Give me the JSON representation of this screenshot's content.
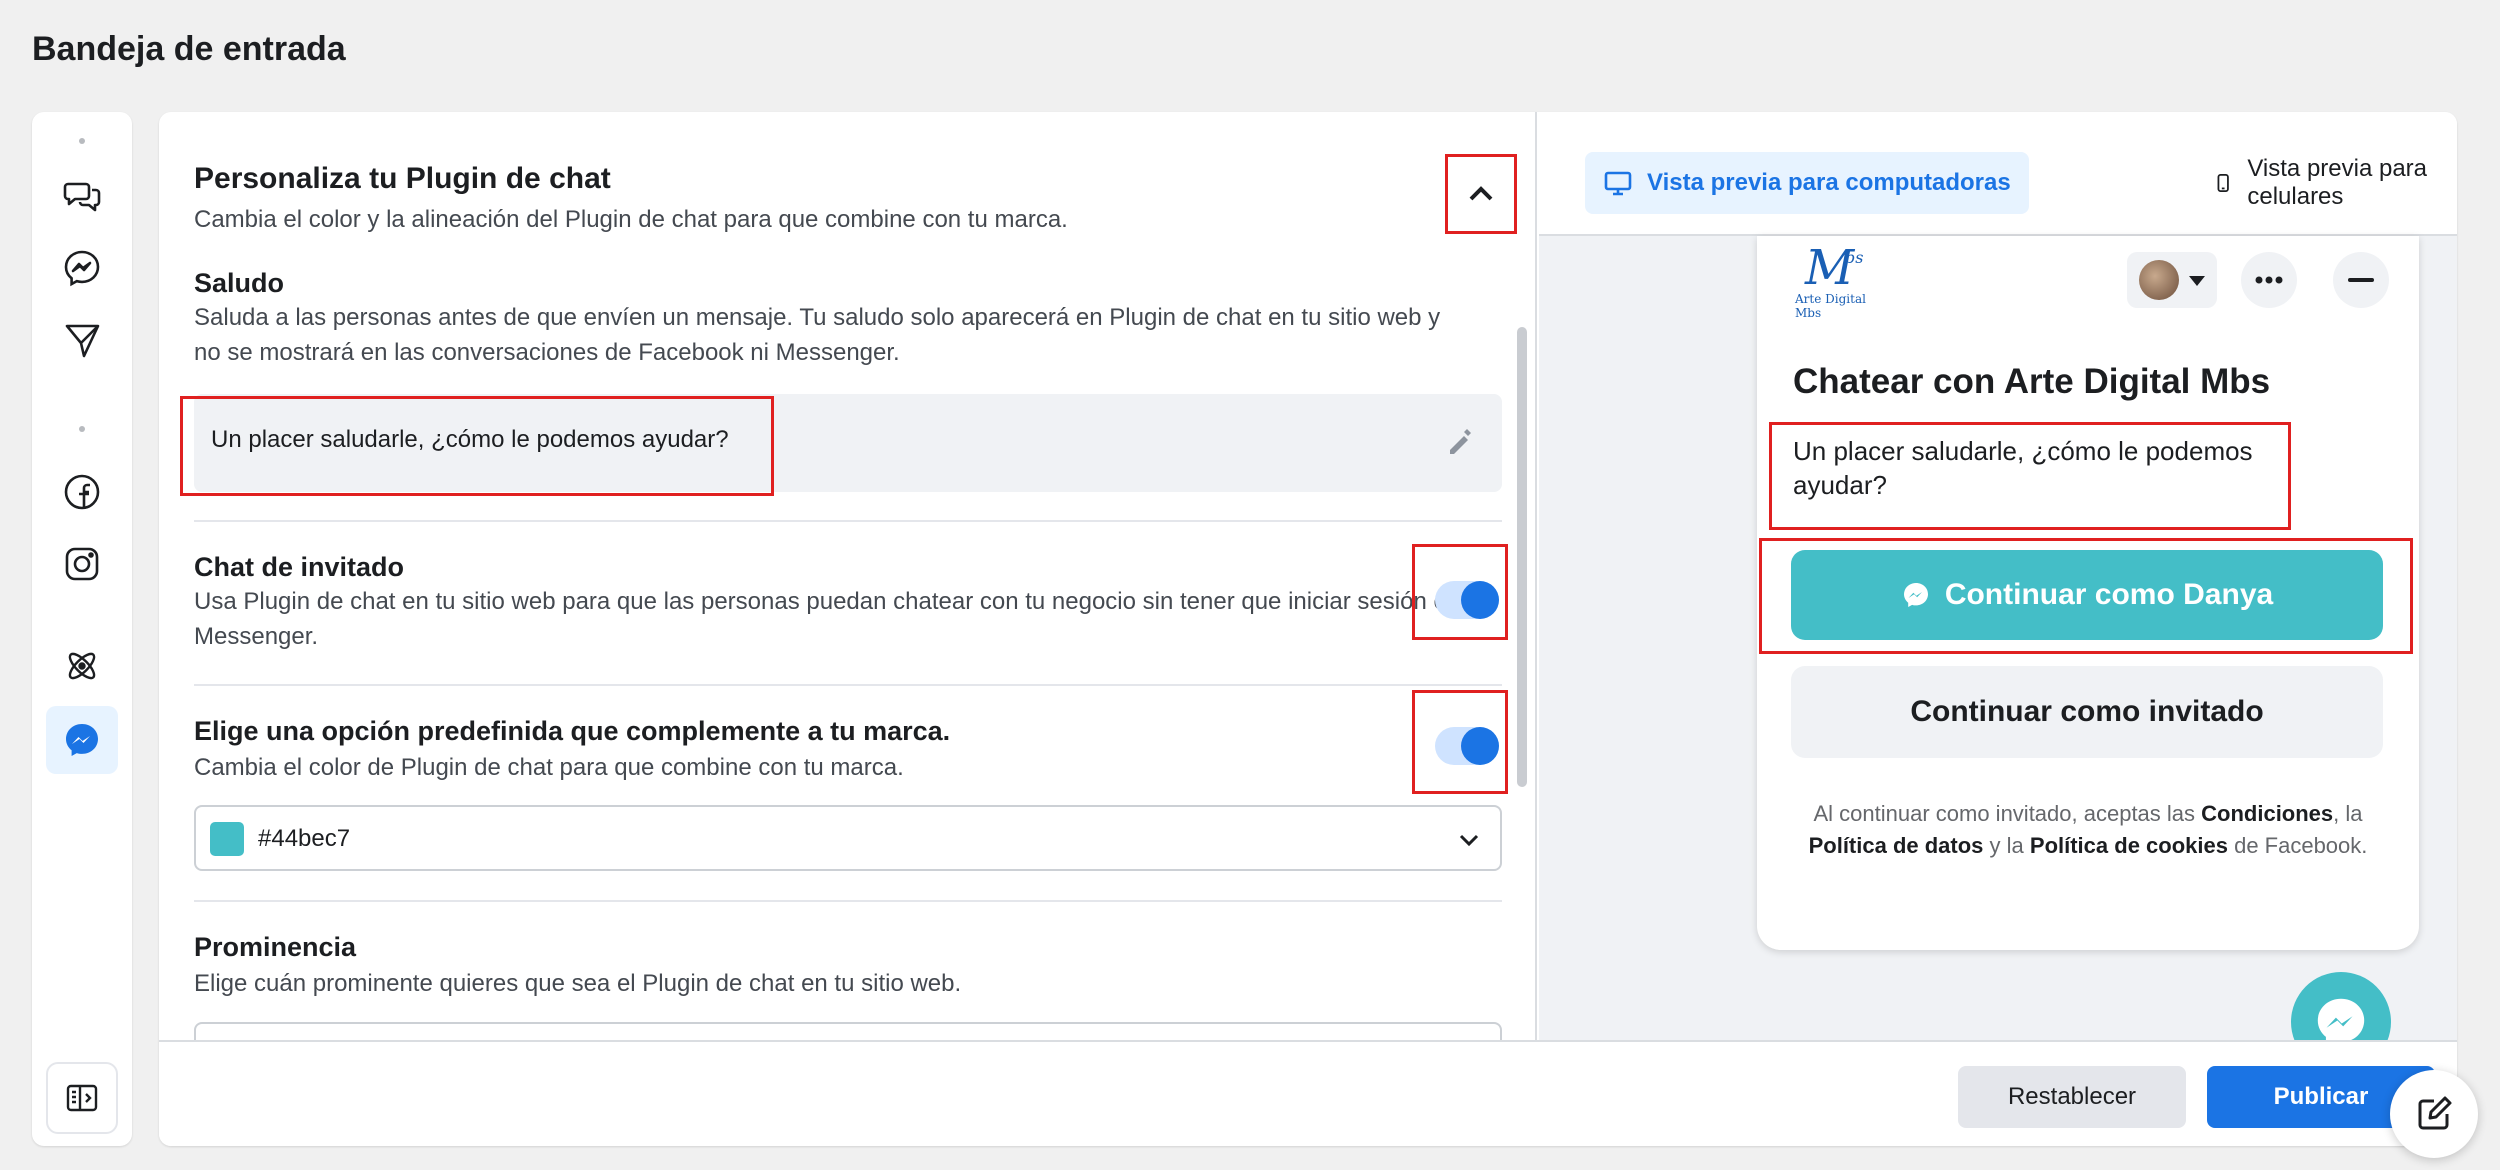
{
  "page": {
    "title": "Bandeja de entrada"
  },
  "sidebar": {
    "items": [
      {
        "icon": "comments-icon"
      },
      {
        "icon": "messenger-icon"
      },
      {
        "icon": "send-icon"
      },
      {
        "icon": "facebook-icon"
      },
      {
        "icon": "instagram-icon"
      },
      {
        "icon": "atom-icon"
      },
      {
        "icon": "messenger-icon",
        "active": true
      }
    ],
    "bottom_icon": "panel-toggle-icon"
  },
  "settings": {
    "title": "Personaliza tu Plugin de chat",
    "subtitle": "Cambia el color y la alineación del Plugin de chat para que combine con tu marca.",
    "greeting": {
      "title": "Saludo",
      "description": "Saluda a las personas antes de que envíen un mensaje. Tu saludo solo aparecerá en Plugin de chat en tu sitio web y no se mostrará en las conversaciones de Facebook ni Messenger.",
      "value": "Un placer saludarle, ¿cómo le podemos ayudar?"
    },
    "guest_chat": {
      "title": "Chat de invitado",
      "description": "Usa Plugin de chat en tu sitio web para que las personas puedan chatear con tu negocio sin tener que iniciar sesión en Messenger.",
      "enabled": true
    },
    "preset": {
      "title": "Elige una opción predefinida que complemente a tu marca.",
      "description": "Cambia el color de Plugin de chat para que combine con tu marca.",
      "enabled": true,
      "color_value": "#44bec7"
    },
    "prominence": {
      "title": "Prominencia",
      "description": "Elige cuán prominente quieres que sea el Plugin de chat en tu sitio web."
    }
  },
  "preview": {
    "tab_desktop": "Vista previa para computadoras",
    "tab_mobile": "Vista previa para celulares",
    "logo_script": "M",
    "logo_sup": "bs",
    "logo_small": "Arte Digital Mbs",
    "chat_title": "Chatear con Arte Digital Mbs",
    "greeting": "Un placer saludarle, ¿cómo le podemos ayudar?",
    "continue_label": "Continuar como Danya",
    "guest_label": "Continuar como invitado",
    "legal": {
      "p1": "Al continuar como invitado, aceptas las ",
      "b1": "Condiciones",
      "p2": ", la ",
      "b2": "Política de datos",
      "p3": " y la ",
      "b3": "Política de cookies",
      "p4": " de Facebook."
    },
    "accent": "#44bec7"
  },
  "footer": {
    "reset_label": "Restablecer",
    "publish_label": "Publicar"
  },
  "colors": {
    "primary": "#1b74e4",
    "highlight": "#e02020"
  }
}
